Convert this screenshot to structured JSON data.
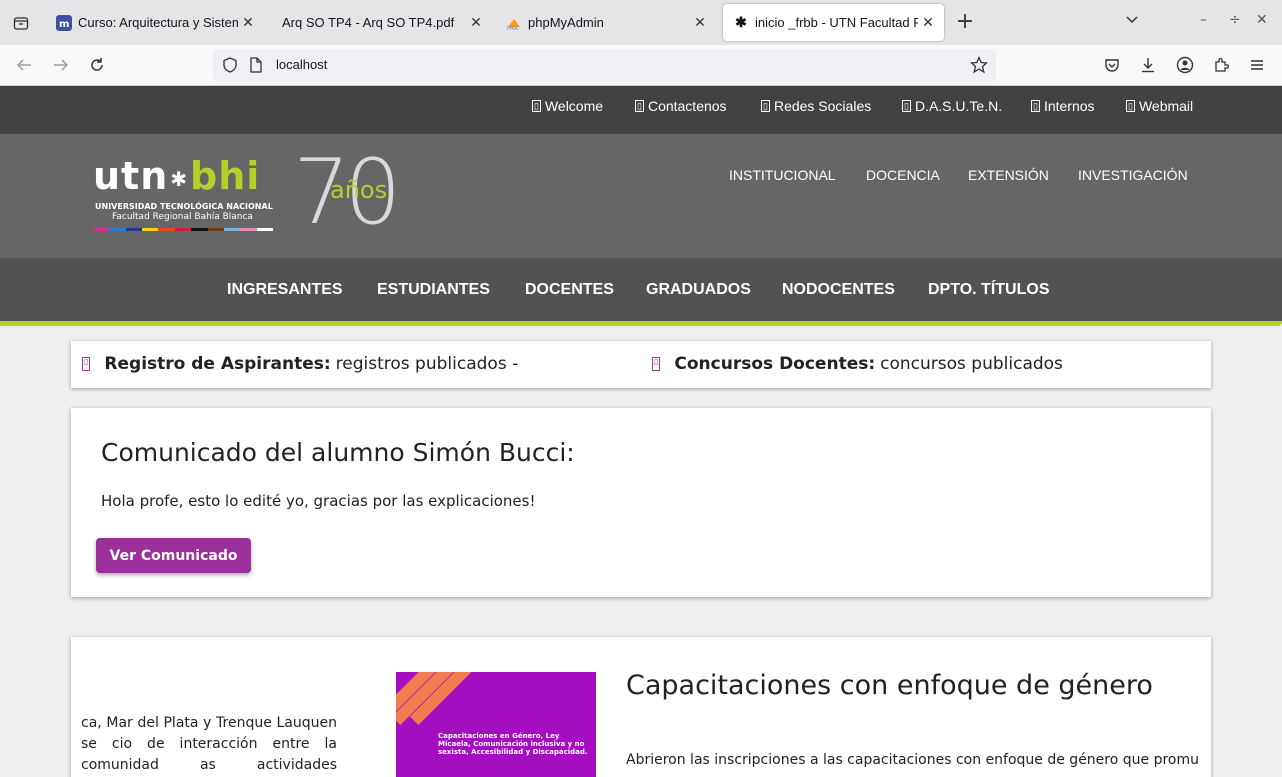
{
  "browser": {
    "tabs": [
      {
        "title": "Curso: Arquitectura y Sistema",
        "favicon": "moodle-icon"
      },
      {
        "title": "Arq SO TP4 - Arq SO TP4.pdf",
        "favicon": "pdf-icon"
      },
      {
        "title": "phpMyAdmin",
        "favicon": "phpmyadmin-icon"
      },
      {
        "title": "inicio _frbb - UTN Facultad Re",
        "favicon": "utn-icon",
        "active": true
      }
    ],
    "url": "localhost"
  },
  "site": {
    "top_links": [
      "Welcome",
      "Contactenos",
      "Redes Sociales",
      "D.A.S.U.Te.N.",
      "Internos",
      "Webmail"
    ],
    "logo": {
      "utn": "utn",
      "bhi": "bhi",
      "line1": "UNIVERSIDAD TECNOLÓGICA NACIONAL",
      "line2": "Facultad Regional Bahía Blanca",
      "seventy": "70",
      "anios": "años"
    },
    "header_nav": [
      "INSTITUCIONAL",
      "DOCENCIA",
      "EXTENSIÓN",
      "INVESTIGACIÓN"
    ],
    "main_menu": [
      "INGRESANTES",
      "ESTUDIANTES",
      "DOCENTES",
      "GRADUADOS",
      "NODOCENTES",
      "DPTO. TÍTULOS"
    ],
    "ticker": [
      {
        "label": "Registro de Aspirantes:",
        "text": "registros publicados -"
      },
      {
        "label": "Concursos Docentes:",
        "text": "concursos publicados"
      }
    ],
    "announcement": {
      "title": "Comunicado del alumno Simón Bucci:",
      "body": "Hola profe, esto lo edité yo, gracias por las explicaciones!",
      "button": "Ver Comunicado"
    },
    "news": {
      "left_text": "ca, Mar del Plata y Trenque Lauquen se cio de interacción entre la comunidad as actividades científicas y tecnológicas",
      "image_caption": "Capacitaciones en Género, Ley Micaela, Comunicación inclusiva y no sexista, Accesibilidad y Discapacidad.",
      "title": "Capacitaciones con enfoque de género",
      "body": "Abrieron las inscripciones a las capacitaciones con enfoque de género que promueve"
    },
    "colors": {
      "accent_green": "#b7cf2b",
      "accent_purple": "#9b2f9b",
      "header_gray": "#666666"
    }
  }
}
